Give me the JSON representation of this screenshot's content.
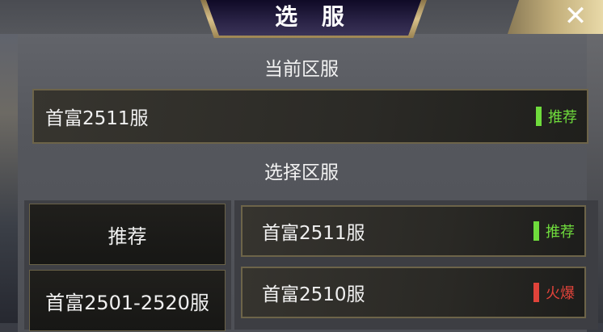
{
  "dialog": {
    "title": "选 服",
    "close_label": "✕"
  },
  "current": {
    "heading": "当前区服",
    "server_name": "首富2511服",
    "tag_label": "推荐",
    "tag_color": "#6fdc3c"
  },
  "select": {
    "heading": "选择区服",
    "categories": [
      {
        "label": "推荐"
      },
      {
        "label": "首富2501-2520服"
      }
    ],
    "servers": [
      {
        "name": "首富2511服",
        "tag": "推荐",
        "tag_color": "#6fdc3c"
      },
      {
        "name": "首富2510服",
        "tag": "火爆",
        "tag_color": "#e0433a"
      }
    ]
  }
}
